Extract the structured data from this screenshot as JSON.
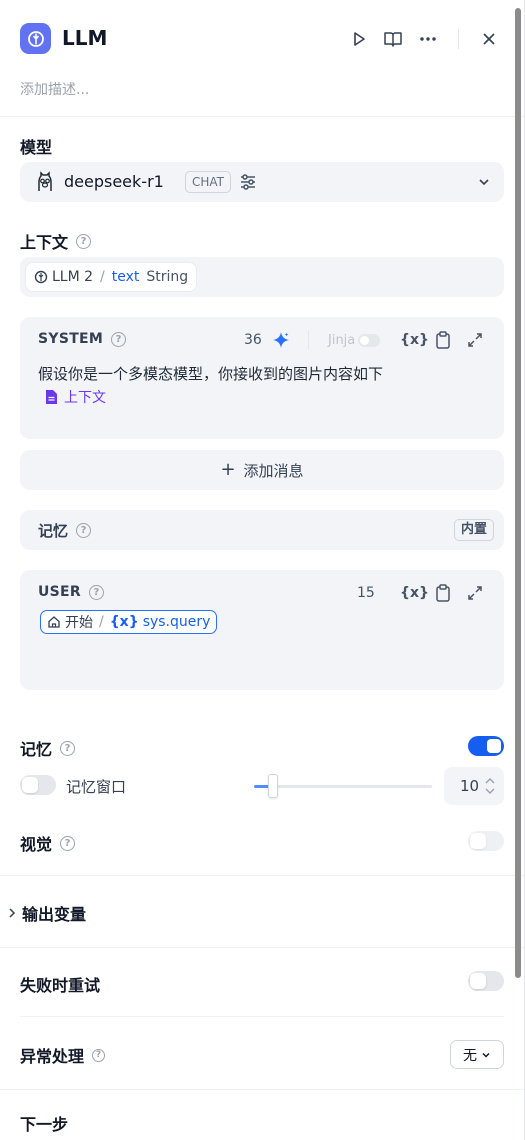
{
  "header": {
    "title": "LLM",
    "description_placeholder": "添加描述...",
    "icons": [
      "run-icon",
      "book-icon",
      "more-icon",
      "close-icon"
    ]
  },
  "model": {
    "label": "模型",
    "name": "deepseek-r1",
    "mode_badge": "CHAT"
  },
  "context": {
    "label": "上下文",
    "chip": {
      "node": "LLM 2",
      "var": "text",
      "type": "String"
    }
  },
  "system_message": {
    "role": "SYSTEM",
    "token_count": "36",
    "jinja_label": "Jinja",
    "var_label": "{x}",
    "text": "假设你是一个多模态模型，你接收到的图片内容如下",
    "context_tag": "上下文"
  },
  "add_message": {
    "label": "添加消息"
  },
  "memory_builtin": {
    "label": "记忆",
    "badge": "内置"
  },
  "user_message": {
    "role": "USER",
    "token_count": "15",
    "var_label": "{x}",
    "chip": {
      "node": "开始",
      "var_icon": "{x}",
      "var": "sys.query"
    }
  },
  "memory": {
    "label": "记忆",
    "enabled": true,
    "window_label": "记忆窗口",
    "window_enabled": false,
    "window_value": "10",
    "window_slider_fraction": 0.1
  },
  "vision": {
    "label": "视觉",
    "enabled": false
  },
  "output_vars": {
    "label": "输出变量"
  },
  "retry": {
    "label": "失败时重试",
    "enabled": false
  },
  "error_handling": {
    "label": "异常处理",
    "value": "无"
  },
  "next_step": {
    "label": "下一步"
  },
  "colors": {
    "accent": "#155eef",
    "app_icon": "#6172f3",
    "sparkle": "#2970ff",
    "context_tag": "#6938ef"
  }
}
